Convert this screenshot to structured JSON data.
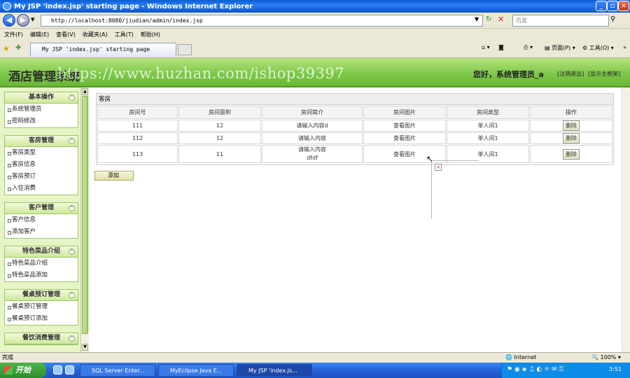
{
  "window": {
    "title": "My JSP 'index.jsp' starting page - Windows Internet Explorer"
  },
  "browser": {
    "address": "http://localhost:8080/jiudian/admin/index.jsp",
    "search_placeholder": "百度",
    "menus": [
      "文件(F)",
      "编辑(E)",
      "查看(V)",
      "收藏夹(A)",
      "工具(T)",
      "帮助(H)"
    ],
    "tab_title": "My JSP 'index.jsp' starting page",
    "toolbar": {
      "page": "页面(P)",
      "tools": "工具(O)"
    }
  },
  "header": {
    "site_title": "酒店管理系统",
    "watermark": "https://www.huzhan.com/ishop39397",
    "greeting": "您好，系统管理员_a",
    "logout": "[注销退出]",
    "show_main": "[显示主框架]"
  },
  "sidebar": {
    "groups": [
      {
        "title": "基本操作",
        "items": [
          "系统管理员",
          "密码修改"
        ]
      },
      {
        "title": "客房管理",
        "items": [
          "客房类型",
          "客房信息",
          "客房预订",
          "入住消费"
        ]
      },
      {
        "title": "客户管理",
        "items": [
          "客户信息",
          "添加客户"
        ]
      },
      {
        "title": "特色菜品介绍",
        "items": [
          "特色菜品介绍",
          "特色菜品添加"
        ]
      },
      {
        "title": "餐桌预订管理",
        "items": [
          "餐桌预订管理",
          "餐桌预订添加"
        ]
      },
      {
        "title": "餐饮消费管理",
        "items": []
      }
    ]
  },
  "main": {
    "panel_title": "客房",
    "columns": [
      "房间号",
      "房间面积",
      "房间简介",
      "房间图片",
      "房间类型",
      "操作"
    ],
    "rows": [
      {
        "no": "111",
        "area": "12",
        "intro": "请输入内容d",
        "intro2": "",
        "image": "查看图片",
        "type": "单人间1",
        "action": "删除"
      },
      {
        "no": "112",
        "area": "12",
        "intro": "请输入内容",
        "intro2": "",
        "image": "查看图片",
        "type": "单人间1",
        "action": "删除"
      },
      {
        "no": "113",
        "area": "11",
        "intro": "请输入内容",
        "intro2": "dfdf",
        "image": "查看图片",
        "type": "单人间1",
        "action": "删除"
      }
    ],
    "add_button": "添加"
  },
  "statusbar": {
    "left": "完成",
    "zone": "Internet",
    "zoom": "100%"
  },
  "taskbar": {
    "start": "开始",
    "tasks": [
      "SQL Server Enter...",
      "MyEclipse Java E...",
      "My JSP 'index.js..."
    ],
    "clock": "3:51"
  }
}
